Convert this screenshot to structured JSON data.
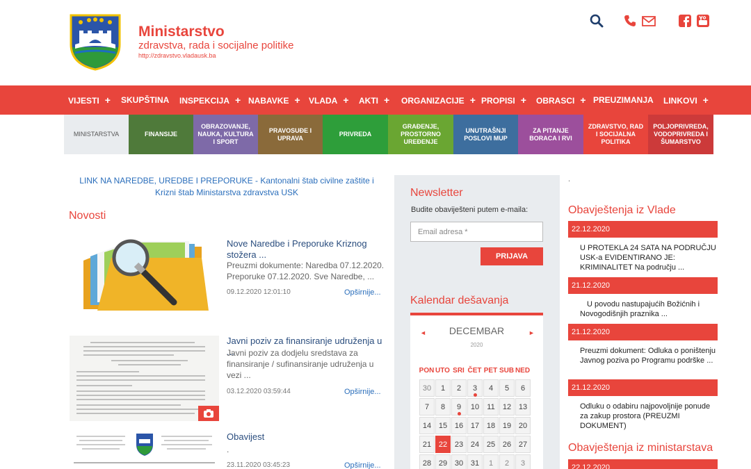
{
  "header": {
    "title": "Ministarstvo",
    "subtitle": "zdravstva, rada i socijalne politike",
    "url": "http://zdravstvo.vladausk.ba"
  },
  "icons": {
    "search": "search-icon",
    "phone": "phone-icon",
    "mail": "mail-icon",
    "facebook": "facebook-icon",
    "youtube": "youtube-icon"
  },
  "colors": {
    "accent": "#e8453c",
    "link": "#2a6ebb",
    "title_link": "#2a4d7e"
  },
  "nav": [
    {
      "label": "VIJESTI",
      "plus": "+"
    },
    {
      "label": "SKUPŠTINA",
      "plus": ""
    },
    {
      "label": "INSPEKCIJA",
      "plus": "+"
    },
    {
      "label": "NABAVKE",
      "plus": "+"
    },
    {
      "label": "VLADA",
      "plus": "+"
    },
    {
      "label": "AKTI",
      "plus": "+"
    },
    {
      "label": "ORGANIZACIJE",
      "plus": "+"
    },
    {
      "label": "PROPISI",
      "plus": "+"
    },
    {
      "label": "OBRASCI",
      "plus": "+"
    },
    {
      "label": "PREUZIMANJA",
      "plus": ""
    },
    {
      "label": "LINKOVI",
      "plus": "+"
    }
  ],
  "tiles": [
    {
      "label": "MINISTARSTVA",
      "color": "#e9ecef"
    },
    {
      "label": "FINANSIJE",
      "color": "#4f7a3a"
    },
    {
      "label": "OBRAZOVANJE, NAUKA, KULTURA I SPORT",
      "color": "#7e6aa8"
    },
    {
      "label": "PRAVOSUĐE I UPRAVA",
      "color": "#8a6a3a"
    },
    {
      "label": "PRIVREDA",
      "color": "#2e9e3a"
    },
    {
      "label": "GRAĐENJE, PROSTORNO UREĐENJE",
      "color": "#6aa632"
    },
    {
      "label": "UNUTRAŠNJI POSLOVI MUP",
      "color": "#3d6e9e"
    },
    {
      "label": "ZA PITANJE BORACA I RVI",
      "color": "#9c4f9c"
    },
    {
      "label": "ZDRAVSTVO, RAD I SOCIJALNA POLITIKA",
      "color": "#e8453c"
    },
    {
      "label": "POLJOPRIVREDA, VODOPRIVREDA I ŠUMARSTVO",
      "color": "#cc3a3a"
    }
  ],
  "notice_link": "LINK NA NAREDBE, UREDBE I PREPORUKE - Kantonalni štab civilne zaštite i Krizni štab Ministarstva zdravstva USK",
  "news_title": "Novosti",
  "news": [
    {
      "title": "Nove Naredbe i Preporuke Kriznog stožera ...",
      "excerpt": "Preuzmi dokumente: Naredba 07.12.2020. Preporuke 07.12.2020. Sve Naredbe, ...",
      "date": "09.12.2020 12:01:10",
      "more": "Opširnije..."
    },
    {
      "title": "Javni poziv za finansiranje udruženja u ...",
      "excerpt": "Javni poziv za dodjelu sredstava za finansiranje / sufinansiranje udruženja u vezi ...",
      "date": "03.12.2020 03:59:44",
      "more": "Opširnije..."
    },
    {
      "title": "Obavijest",
      "excerpt": ".",
      "date": "23.11.2020 03:45:23",
      "more": "Opširnije..."
    }
  ],
  "newsletter": {
    "title": "Newsletter",
    "subtitle": "Budite obaviješteni putem e-maila:",
    "placeholder": "Email adresa *",
    "button": "PRIJAVA"
  },
  "calendar": {
    "title": "Kalendar dešavanja",
    "month": "DECEMBAR",
    "year": "2020",
    "prev": "◄",
    "next": "►",
    "weekdays": [
      "PON",
      "UTO",
      "SRI",
      "ČET",
      "PET",
      "SUB",
      "NED"
    ],
    "weeks": [
      [
        "30",
        "1",
        "2",
        "3",
        "4",
        "5",
        "6"
      ],
      [
        "7",
        "8",
        "9",
        "10",
        "11",
        "12",
        "13"
      ],
      [
        "14",
        "15",
        "16",
        "17",
        "18",
        "19",
        "20"
      ],
      [
        "21",
        "22",
        "23",
        "24",
        "25",
        "26",
        "27"
      ],
      [
        "28",
        "29",
        "30",
        "31",
        "1",
        "2",
        "3"
      ]
    ],
    "today": "22",
    "events": [
      "3",
      "9"
    ]
  },
  "right": {
    "dot": ".",
    "vlada_title": "Obavještenja iz Vlade",
    "items": [
      {
        "date": "22.12.2020",
        "text": "U PROTEKLA 24 SATA NA PODRUČJU USK-a EVIDENTIRANO JE: KRIMINALITET Na području ..."
      },
      {
        "date": "21.12.2020",
        "text": "U povodu nastupajućih Božićnih i Novogodišnjih praznika ..."
      },
      {
        "date": "21.12.2020",
        "text": "Preuzmi dokument: Odluka o poništenju Javnog poziva po Programu podrške ..."
      },
      {
        "date": "21.12.2020",
        "text": "Odluku o odabiru najpovoljnije ponude za zakup prostora (PREUZMI DOKUMENT)"
      }
    ],
    "ministry_title": "Obavještenja iz ministarstava",
    "ministry_first_date": "22.12.2020"
  }
}
